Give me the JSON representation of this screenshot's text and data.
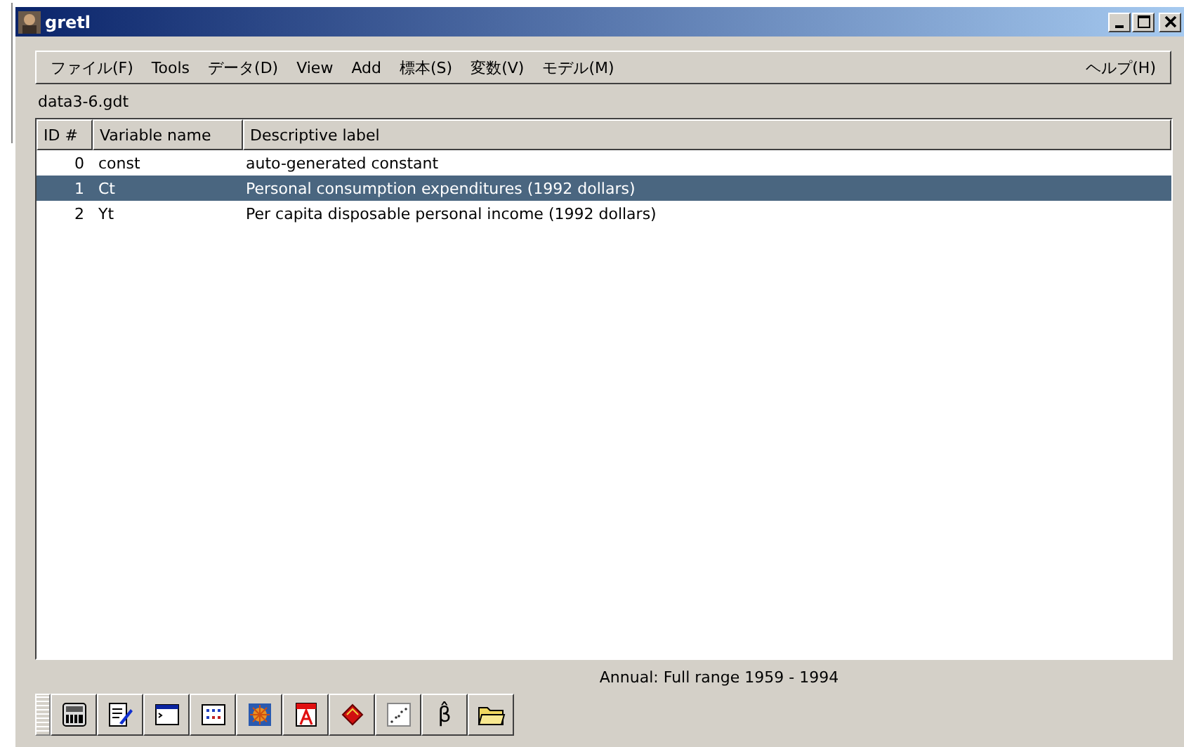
{
  "window": {
    "title": "gretl"
  },
  "menu": [
    "ファイル(F)",
    "Tools",
    "データ(D)",
    "View",
    "Add",
    "標本(S)",
    "変数(V)",
    "モデル(M)"
  ],
  "help_menu": "ヘルプ(H)",
  "file_name": "data3-6.gdt",
  "table": {
    "columns": [
      "ID #",
      "Variable name",
      "Descriptive label"
    ],
    "rows": [
      {
        "id": "0",
        "name": "const",
        "label": "auto-generated constant",
        "selected": false
      },
      {
        "id": "1",
        "name": "Ct",
        "label": "Personal consumption expenditures (1992 dollars)",
        "selected": true
      },
      {
        "id": "2",
        "name": "Yt",
        "label": "Per capita disposable personal income (1992 dollars)",
        "selected": false
      }
    ]
  },
  "status": "Annual: Full range 1959 - 1994",
  "toolbar": [
    {
      "kind": "calculator"
    },
    {
      "kind": "edit"
    },
    {
      "kind": "console"
    },
    {
      "kind": "matrix"
    },
    {
      "kind": "session"
    },
    {
      "kind": "pdf"
    },
    {
      "kind": "book"
    },
    {
      "kind": "scatter"
    },
    {
      "kind": "beta",
      "text": "β̂"
    },
    {
      "kind": "folder"
    }
  ]
}
